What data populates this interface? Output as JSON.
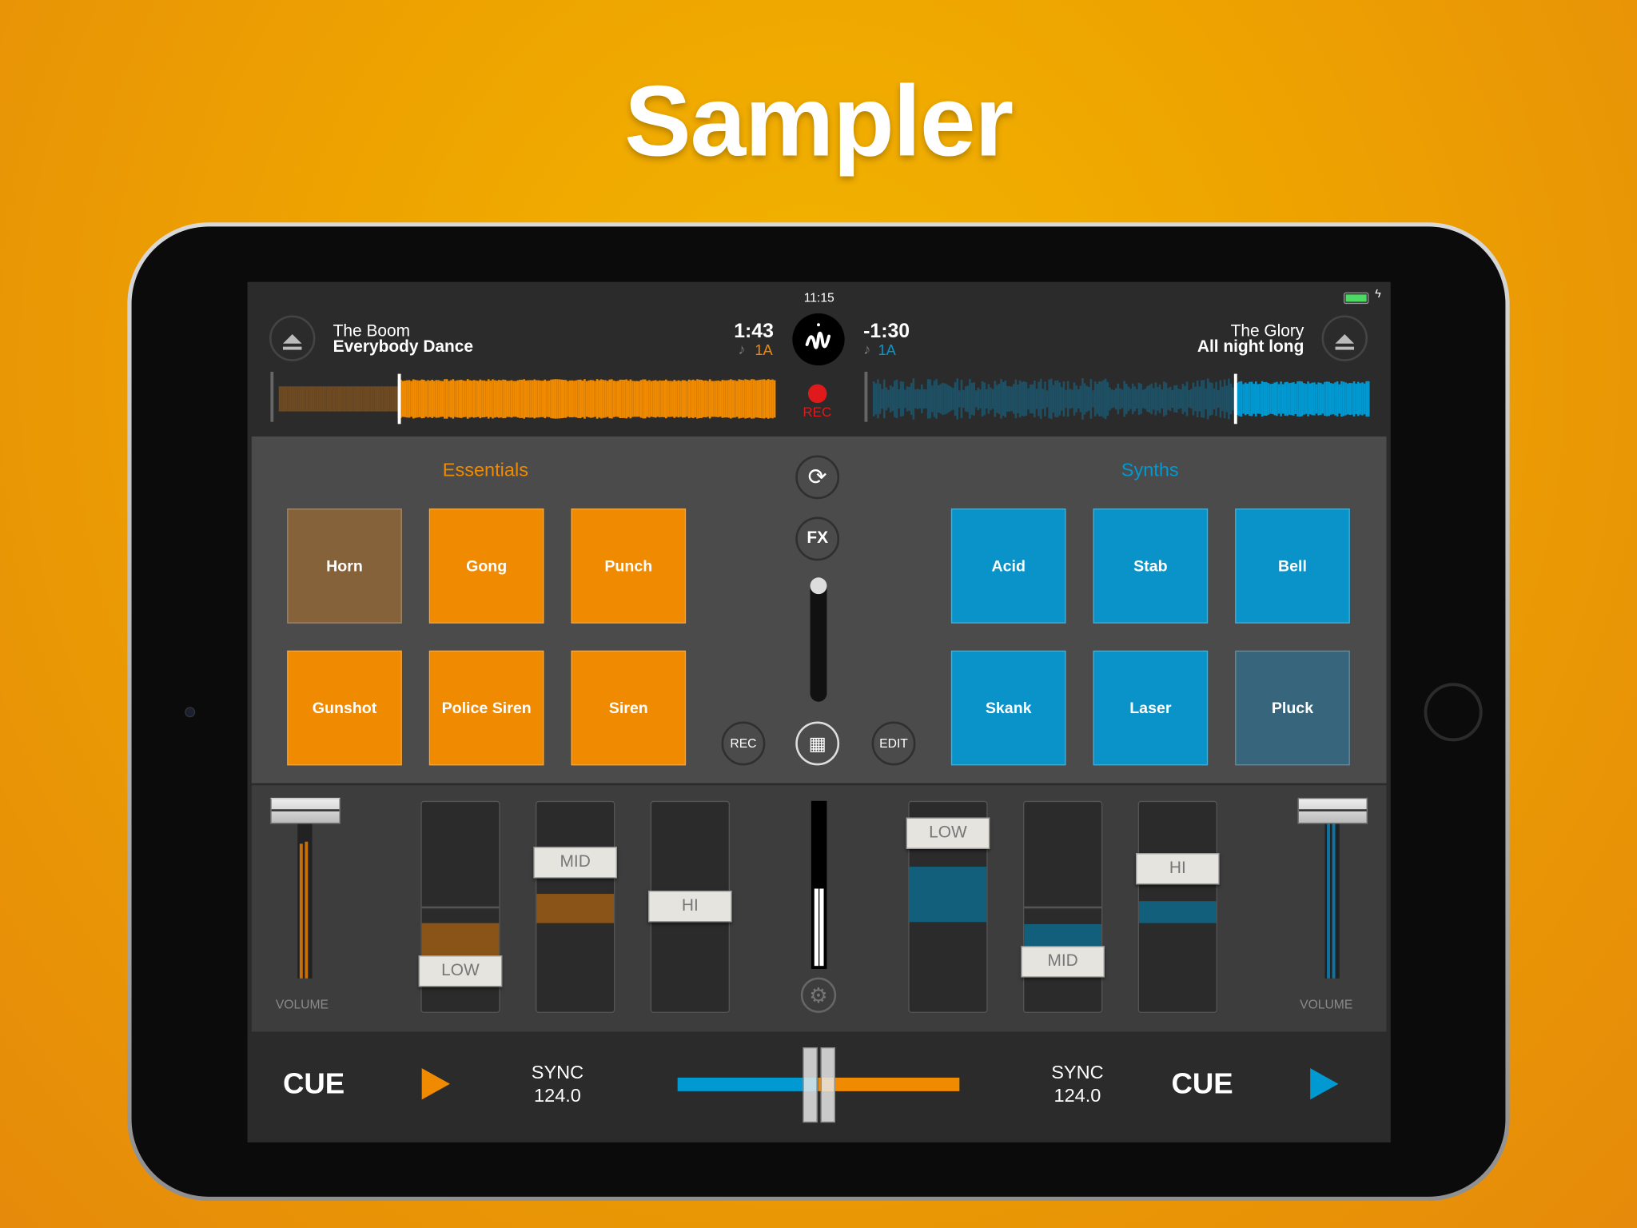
{
  "headline": "Sampler",
  "status": {
    "time": "11:15",
    "battery": "charging-full"
  },
  "colors": {
    "left_accent": "#f08a00",
    "right_accent": "#0099d2"
  },
  "deck_left": {
    "artist": "The Boom",
    "title": "Everybody Dance",
    "time": "1:43",
    "key": "1A",
    "position": 0.24
  },
  "deck_right": {
    "artist": "The Glory",
    "title": "All night long",
    "time": "-1:30",
    "key": "1A",
    "position": 0.73
  },
  "center": {
    "rec_label": "REC"
  },
  "sampler": {
    "left_bank": "Essentials",
    "right_bank": "Synths",
    "left_pads": [
      "Horn",
      "Gong",
      "Punch",
      "Gunshot",
      "Police Siren",
      "Siren"
    ],
    "right_pads": [
      "Acid",
      "Stab",
      "Bell",
      "Skank",
      "Laser",
      "Pluck"
    ],
    "fx_label": "FX",
    "rec_label": "REC",
    "edit_label": "EDIT"
  },
  "mixer": {
    "volume_label": "VOLUME",
    "left_eq": [
      {
        "label": "LOW"
      },
      {
        "label": "MID"
      },
      {
        "label": "HI"
      }
    ],
    "right_eq": [
      {
        "label": "LOW"
      },
      {
        "label": "MID"
      },
      {
        "label": "HI"
      }
    ]
  },
  "transport": {
    "cue": "CUE",
    "sync": "SYNC",
    "bpm_left": "124.0",
    "bpm_right": "124.0",
    "crossfader": 0.5
  }
}
